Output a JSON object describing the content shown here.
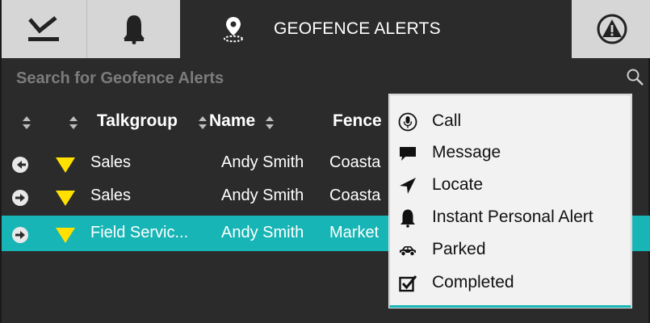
{
  "tabs": [
    {
      "icon": "checkmark-underline-icon"
    },
    {
      "icon": "bell-icon"
    },
    {
      "icon": "geofence-pin-icon",
      "title": "GEOFENCE ALERTS"
    },
    {
      "icon": "emergency-triangle-icon"
    }
  ],
  "search": {
    "placeholder": "Search for Geofence Alerts"
  },
  "table": {
    "columns": [
      "Talkgroup",
      "Name",
      "Fence"
    ],
    "rows": [
      {
        "talkgroup": "Sales",
        "name": "Andy Smith",
        "fence": "Coasta",
        "status_icon": "exit-arrow-icon",
        "priority_icon": "yellow-triangle-icon"
      },
      {
        "talkgroup": "Sales",
        "name": "Andy Smith",
        "fence": "Coasta",
        "status_icon": "enter-arrow-icon",
        "priority_icon": "yellow-triangle-icon"
      },
      {
        "talkgroup": "Field Servic...",
        "name": "Andy Smith",
        "fence": "Market",
        "status_icon": "enter-arrow-icon",
        "priority_icon": "yellow-triangle-icon",
        "selected": true
      }
    ]
  },
  "context_menu": {
    "items": [
      {
        "label": "Call",
        "icon": "microphone-icon"
      },
      {
        "label": "Message",
        "icon": "speech-bubble-icon"
      },
      {
        "label": "Locate",
        "icon": "navigation-arrow-icon"
      },
      {
        "label": "Instant Personal Alert",
        "icon": "bell-icon"
      },
      {
        "label": "Parked",
        "icon": "car-icon"
      },
      {
        "label": "Completed",
        "icon": "checkbox-icon"
      }
    ]
  },
  "colors": {
    "background": "#2b2b2b",
    "tab_inactive": "#d6d6d6",
    "selection": "#17b5b5",
    "priority": "#ffe000",
    "menu_background": "#f2f2f2"
  }
}
